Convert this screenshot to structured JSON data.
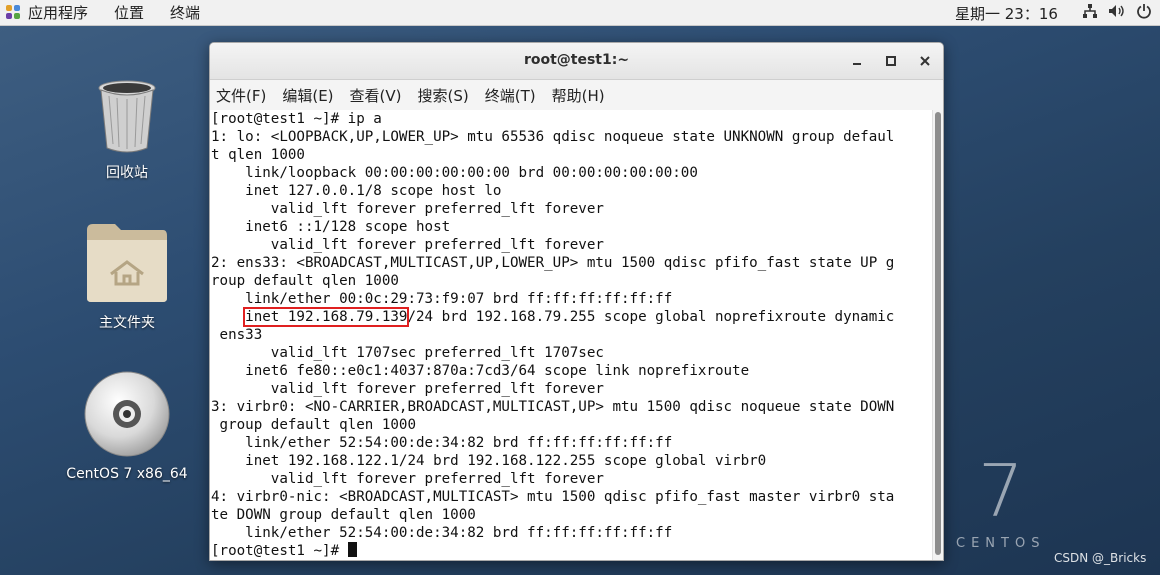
{
  "top_panel": {
    "apps": "应用程序",
    "places": "位置",
    "terminal": "终端",
    "clock": "星期一 23：16",
    "tray_icons": [
      "network-icon",
      "volume-icon",
      "power-icon"
    ]
  },
  "desktop": {
    "trash": "回收站",
    "home": "主文件夹",
    "disc": "CentOS 7 x86_64",
    "watermark_number": "7",
    "watermark_word": "CENTOS",
    "credit": "CSDN @_Bricks"
  },
  "window": {
    "title": "root@test1:~",
    "menu": [
      "文件(F)",
      "编辑(E)",
      "查看(V)",
      "搜索(S)",
      "终端(T)",
      "帮助(H)"
    ]
  },
  "terminal": {
    "lines": [
      "[root@test1 ~]# ip a",
      "1: lo: <LOOPBACK,UP,LOWER_UP> mtu 65536 qdisc noqueue state UNKNOWN group defaul",
      "t qlen 1000",
      "    link/loopback 00:00:00:00:00:00 brd 00:00:00:00:00:00",
      "    inet 127.0.0.1/8 scope host lo",
      "       valid_lft forever preferred_lft forever",
      "    inet6 ::1/128 scope host",
      "       valid_lft forever preferred_lft forever",
      "2: ens33: <BROADCAST,MULTICAST,UP,LOWER_UP> mtu 1500 qdisc pfifo_fast state UP g",
      "roup default qlen 1000",
      "    link/ether 00:0c:29:73:f9:07 brd ff:ff:ff:ff:ff:ff",
      "",
      " ens33",
      "       valid_lft 1707sec preferred_lft 1707sec",
      "    inet6 fe80::e0c1:4037:870a:7cd3/64 scope link noprefixroute",
      "       valid_lft forever preferred_lft forever",
      "3: virbr0: <NO-CARRIER,BROADCAST,MULTICAST,UP> mtu 1500 qdisc noqueue state DOWN",
      " group default qlen 1000",
      "    link/ether 52:54:00:de:34:82 brd ff:ff:ff:ff:ff:ff",
      "    inet 192.168.122.1/24 brd 192.168.122.255 scope global virbr0",
      "       valid_lft forever preferred_lft forever",
      "4: virbr0-nic: <BROADCAST,MULTICAST> mtu 1500 qdisc pfifo_fast master virbr0 sta",
      "te DOWN group default qlen 1000",
      "    link/ether 52:54:00:de:34:82 brd ff:ff:ff:ff:ff:ff",
      "[root@test1 ~]# "
    ],
    "highlight_prefix": "    ",
    "highlight_text": "inet 192.168.79.139",
    "highlight_suffix": "/24 brd 192.168.79.255 scope global noprefixroute dynamic"
  }
}
